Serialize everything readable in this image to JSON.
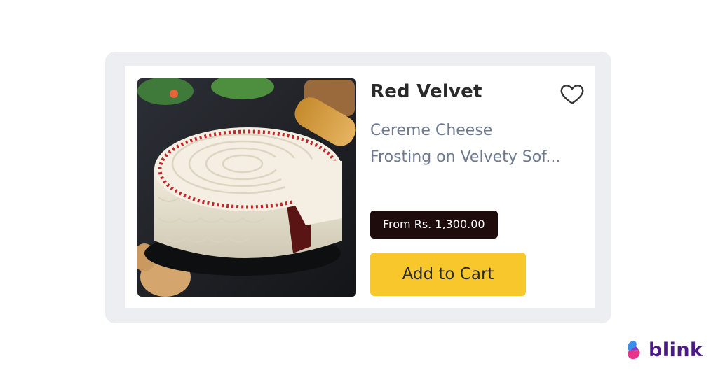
{
  "product": {
    "name": "Red Velvet",
    "description_line1": "Cereme Cheese",
    "description_line2": "Frosting on Velvety Sof...",
    "price": "From Rs. 1,300.00",
    "cart_label": "Add to Cart",
    "image_icon": "red-velvet-cake-photo",
    "wishlist_icon": "heart-outline-icon"
  },
  "brand": {
    "name": "blink",
    "icon": "blink-logo-icon"
  },
  "colors": {
    "cart_button": "#f8c72b",
    "price_badge": "#1e0b0b",
    "brand_text": "#4a1a85",
    "card_frame": "#eceef1"
  }
}
